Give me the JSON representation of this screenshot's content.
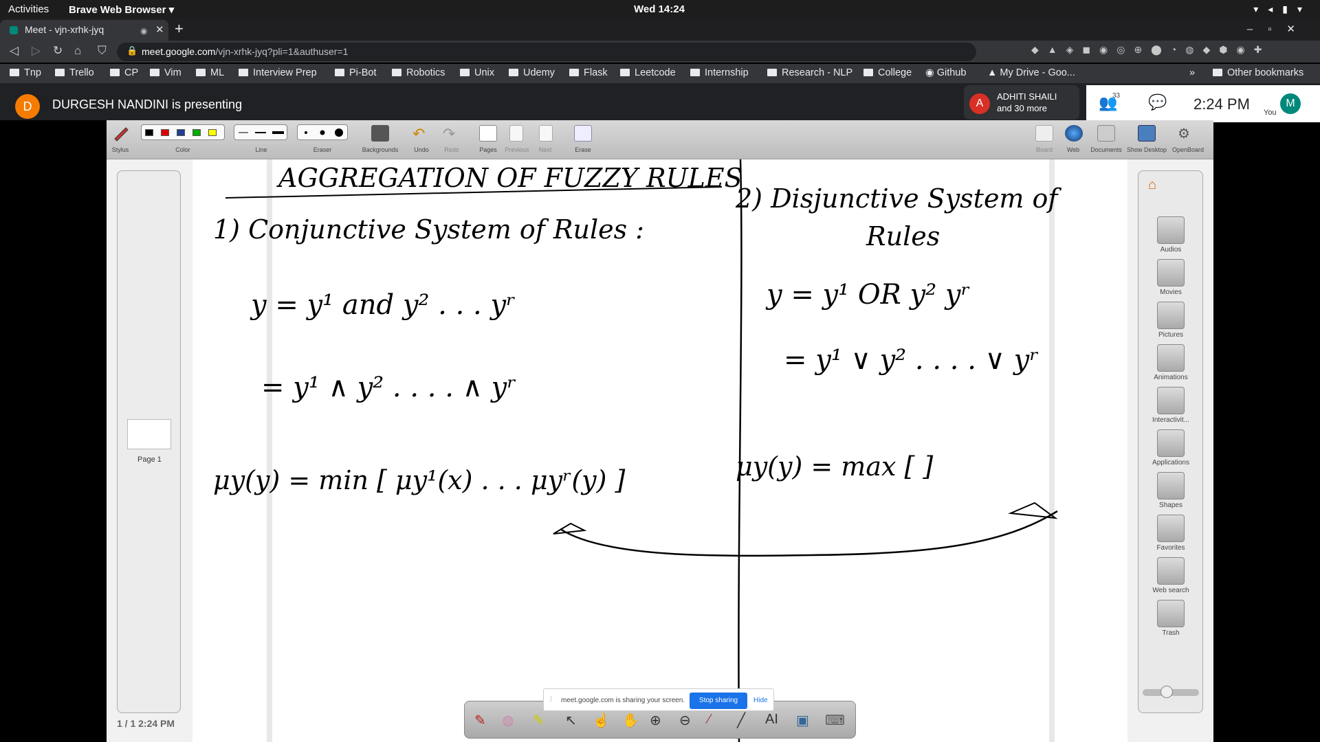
{
  "topbar": {
    "activities": "Activities",
    "app": "Brave Web Browser ▾",
    "clock": "Wed 14:24"
  },
  "tab": {
    "title": "Meet - vjn-xrhk-jyq"
  },
  "address": {
    "host": "meet.google.com",
    "path": "/vjn-xrhk-jyq?pli=1&authuser=1"
  },
  "bookmarks": [
    "Tnp",
    "Trello",
    "CP",
    "Vim",
    "ML",
    "Interview Prep",
    "Pi-Bot",
    "Robotics",
    "Unix",
    "Udemy",
    "Flask",
    "Leetcode",
    "Internship",
    "Research - NLP",
    "College",
    "Github",
    "My Drive - Goo...",
    "Other bookmarks"
  ],
  "meet": {
    "presenter_initial": "D",
    "presenter_text": "DURGESH NANDINI is presenting",
    "participant_initial": "A",
    "participant_name": "ADHITI SHAILI",
    "participant_more": "and 30 more",
    "people_count": "33",
    "time": "2:24 PM",
    "you_initial": "M",
    "you_label": "You"
  },
  "openboard": {
    "left_tools": [
      "Stylus",
      "Color",
      "Line",
      "Eraser",
      "Backgrounds",
      "Undo",
      "Redo",
      "Pages",
      "Previous",
      "Next",
      "Erase"
    ],
    "right_tools": [
      "Board",
      "Web",
      "Documents",
      "Show Desktop",
      "OpenBoard"
    ],
    "page_label": "Page 1",
    "page_counter": "1 / 1 2:24 PM",
    "library": [
      "Audios",
      "Movies",
      "Pictures",
      "Animations",
      "Interactivit...",
      "Applications",
      "Shapes",
      "Favorites",
      "Web search",
      "Trash"
    ]
  },
  "share": {
    "text": "meet.google.com is sharing your screen.",
    "stop": "Stop sharing",
    "hide": "Hide"
  },
  "handwriting": {
    "title": "AGGREGATION OF FUZZY RULES",
    "left_heading": "1) Conjunctive System of Rules :",
    "left_eq1": "y = y¹ and y² . . .  yʳ",
    "left_eq2": "= y¹ ∧ y² . . . . ∧ yʳ",
    "left_eq3": "μy(y) = min [ μy¹(x) . . . μyʳ(y) ]",
    "right_heading": "2) Disjunctive System of",
    "right_heading2": "Rules",
    "right_eq1": "y = y¹ OR y²  yʳ",
    "right_eq2": "= y¹ ∨ y² . . . . ∨ yʳ",
    "right_eq3": "μy(y) = max [          ]"
  },
  "colors": {
    "accent": "#1a73e8",
    "presenter": "#f57c00",
    "participant": "#d93025",
    "you": "#00897b"
  }
}
